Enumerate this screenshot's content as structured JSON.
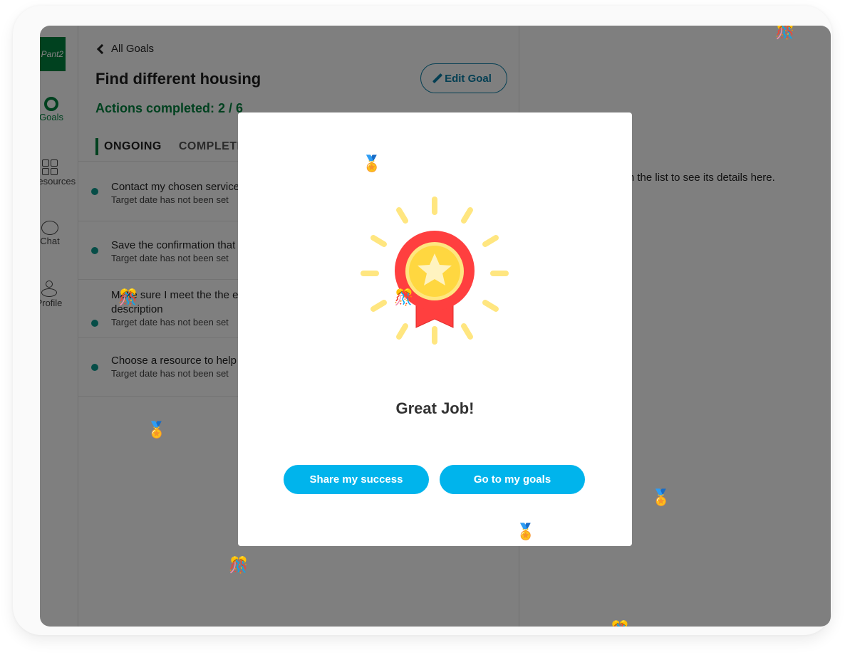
{
  "sidebar": {
    "logo_text": "Pant2",
    "items": [
      {
        "label": "Goals",
        "icon": "circle-ring-icon",
        "active": true
      },
      {
        "label": "Resources",
        "icon": "grid-icon"
      },
      {
        "label": "Chat",
        "icon": "chat-bubble-icon"
      },
      {
        "label": "Profile",
        "icon": "person-icon"
      }
    ]
  },
  "main": {
    "back_label": "All Goals",
    "goal_title": "Find different housing",
    "edit_label": "Edit Goal",
    "progress_text": "Actions completed: 2 / 6",
    "progress": {
      "completed": 2,
      "total": 6
    },
    "tabs": [
      {
        "label": "ONGOING",
        "active": true
      },
      {
        "label": "COMPLETED"
      }
    ],
    "actions": [
      {
        "title": "Contact my chosen service",
        "subtitle": "Target date has not been set"
      },
      {
        "title": "Save the confirmation that",
        "subtitle": "Target date has not been set"
      },
      {
        "title": "Make sure I meet the the e",
        "title_line2": "description",
        "subtitle": "Target date has not been set"
      },
      {
        "title": "Choose a resource to help",
        "subtitle": "Target date has not been set"
      }
    ]
  },
  "detail": {
    "placeholder": "Select a task from the list to see its details here."
  },
  "modal": {
    "icon": "award-medal-icon",
    "heading": "Great Job!",
    "share_label": "Share my success",
    "goals_label": "Go to my goals"
  },
  "confetti": {
    "medal": "🏅",
    "popper": "🎊"
  },
  "colors": {
    "brand_green": "#00833f",
    "teal_dot": "#0c9b8f",
    "edit_blue": "#0a7fa6",
    "button_blue": "#00b4ec",
    "medal_red": "#ff3f3f",
    "medal_gold": "#ffd740",
    "rays": "#ffe680"
  }
}
